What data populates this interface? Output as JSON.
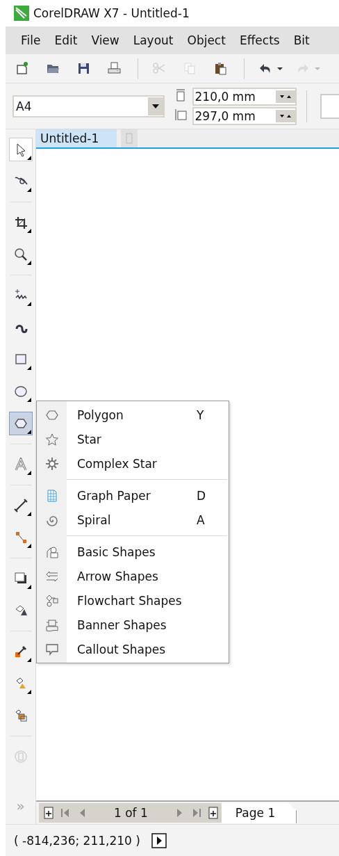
{
  "window": {
    "title": "CorelDRAW X7 - Untitled-1"
  },
  "menubar": [
    "File",
    "Edit",
    "View",
    "Layout",
    "Object",
    "Effects",
    "Bit"
  ],
  "standard_toolbar": [
    {
      "kind": "new",
      "disabled": false
    },
    {
      "kind": "open",
      "disabled": false
    },
    {
      "kind": "save",
      "disabled": false
    },
    {
      "kind": "print",
      "disabled": false
    },
    {
      "kind": "separator"
    },
    {
      "kind": "cut",
      "disabled": true
    },
    {
      "kind": "copy",
      "disabled": true
    },
    {
      "kind": "paste",
      "disabled": false
    },
    {
      "kind": "separator"
    },
    {
      "kind": "undo",
      "disabled": false
    },
    {
      "kind": "dropdown",
      "disabled": false
    },
    {
      "kind": "redo",
      "disabled": true
    },
    {
      "kind": "dropdown",
      "disabled": true
    }
  ],
  "property_bar": {
    "page_size": "A4",
    "width": "210,0 mm",
    "height": "297,0 mm"
  },
  "document_tab": {
    "title": "Untitled-1"
  },
  "toolbox": [
    {
      "kind": "pick",
      "selected": false,
      "flyout": true,
      "disabled": false
    },
    {
      "kind": "shape",
      "selected": false,
      "flyout": true,
      "disabled": false
    },
    {
      "kind": "separator"
    },
    {
      "kind": "crop",
      "selected": false,
      "flyout": true,
      "disabled": false
    },
    {
      "kind": "zoom",
      "selected": false,
      "flyout": true,
      "disabled": false
    },
    {
      "kind": "separator"
    },
    {
      "kind": "freehand",
      "selected": false,
      "flyout": true,
      "disabled": false
    },
    {
      "kind": "artistic",
      "selected": false,
      "flyout": false,
      "disabled": false
    },
    {
      "kind": "rectangle",
      "selected": false,
      "flyout": true,
      "disabled": false
    },
    {
      "kind": "ellipse",
      "selected": false,
      "flyout": true,
      "disabled": false
    },
    {
      "kind": "polygon",
      "selected": true,
      "flyout": true,
      "disabled": false
    },
    {
      "kind": "separator"
    },
    {
      "kind": "text",
      "selected": false,
      "flyout": true,
      "disabled": false
    },
    {
      "kind": "separator"
    },
    {
      "kind": "dimension",
      "selected": false,
      "flyout": true,
      "disabled": false
    },
    {
      "kind": "connector",
      "selected": false,
      "flyout": true,
      "disabled": false
    },
    {
      "kind": "separator"
    },
    {
      "kind": "shadow",
      "selected": false,
      "flyout": true,
      "disabled": false
    },
    {
      "kind": "transparency",
      "selected": false,
      "flyout": false,
      "disabled": false
    },
    {
      "kind": "separator"
    },
    {
      "kind": "eyedropper",
      "selected": false,
      "flyout": true,
      "disabled": false
    },
    {
      "kind": "fill",
      "selected": false,
      "flyout": true,
      "disabled": false
    },
    {
      "kind": "smartfill",
      "selected": false,
      "flyout": false,
      "disabled": false
    },
    {
      "kind": "separator"
    },
    {
      "kind": "frame",
      "selected": false,
      "flyout": false,
      "disabled": true
    }
  ],
  "toolbox_overflow": "»",
  "flyout": [
    {
      "kind": "polygon",
      "label": "Polygon",
      "shortcut": "Y"
    },
    {
      "kind": "star",
      "label": "Star"
    },
    {
      "kind": "complexstar",
      "label": "Complex Star"
    },
    {
      "kind": "separator"
    },
    {
      "kind": "graphpaper",
      "label": "Graph Paper",
      "shortcut": "D"
    },
    {
      "kind": "spiral",
      "label": "Spiral",
      "shortcut": "A"
    },
    {
      "kind": "separator"
    },
    {
      "kind": "basic",
      "label": "Basic Shapes"
    },
    {
      "kind": "arrow",
      "label": "Arrow Shapes"
    },
    {
      "kind": "flowchart",
      "label": "Flowchart Shapes"
    },
    {
      "kind": "banner",
      "label": "Banner Shapes"
    },
    {
      "kind": "callout",
      "label": "Callout Shapes"
    }
  ],
  "page_navigator": {
    "counter": "1 of 1",
    "page_tab": "Page 1"
  },
  "status_bar": {
    "coordinates": "( -814,236; 211,210 )"
  }
}
